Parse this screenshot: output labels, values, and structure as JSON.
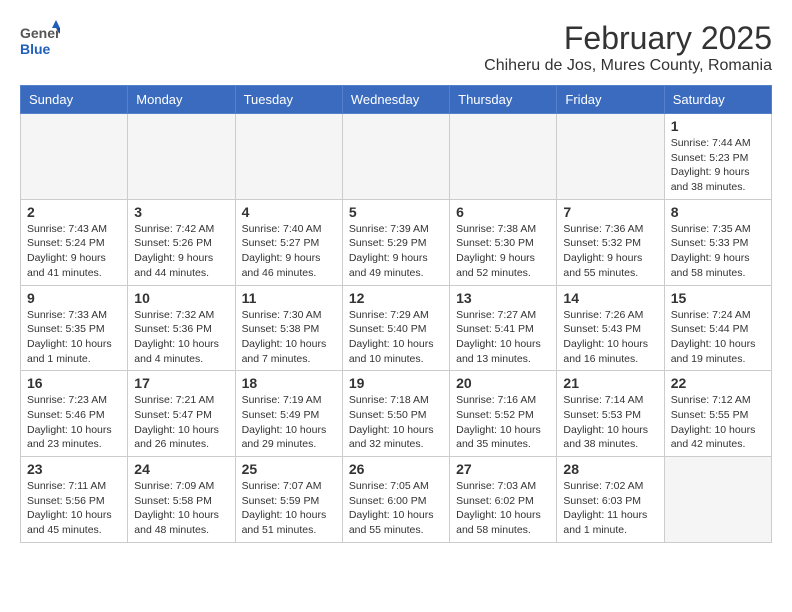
{
  "header": {
    "logo_general": "General",
    "logo_blue": "Blue",
    "month_year": "February 2025",
    "location": "Chiheru de Jos, Mures County, Romania"
  },
  "weekdays": [
    "Sunday",
    "Monday",
    "Tuesday",
    "Wednesday",
    "Thursday",
    "Friday",
    "Saturday"
  ],
  "weeks": [
    [
      {
        "day": "",
        "info": ""
      },
      {
        "day": "",
        "info": ""
      },
      {
        "day": "",
        "info": ""
      },
      {
        "day": "",
        "info": ""
      },
      {
        "day": "",
        "info": ""
      },
      {
        "day": "",
        "info": ""
      },
      {
        "day": "1",
        "info": "Sunrise: 7:44 AM\nSunset: 5:23 PM\nDaylight: 9 hours and 38 minutes."
      }
    ],
    [
      {
        "day": "2",
        "info": "Sunrise: 7:43 AM\nSunset: 5:24 PM\nDaylight: 9 hours and 41 minutes."
      },
      {
        "day": "3",
        "info": "Sunrise: 7:42 AM\nSunset: 5:26 PM\nDaylight: 9 hours and 44 minutes."
      },
      {
        "day": "4",
        "info": "Sunrise: 7:40 AM\nSunset: 5:27 PM\nDaylight: 9 hours and 46 minutes."
      },
      {
        "day": "5",
        "info": "Sunrise: 7:39 AM\nSunset: 5:29 PM\nDaylight: 9 hours and 49 minutes."
      },
      {
        "day": "6",
        "info": "Sunrise: 7:38 AM\nSunset: 5:30 PM\nDaylight: 9 hours and 52 minutes."
      },
      {
        "day": "7",
        "info": "Sunrise: 7:36 AM\nSunset: 5:32 PM\nDaylight: 9 hours and 55 minutes."
      },
      {
        "day": "8",
        "info": "Sunrise: 7:35 AM\nSunset: 5:33 PM\nDaylight: 9 hours and 58 minutes."
      }
    ],
    [
      {
        "day": "9",
        "info": "Sunrise: 7:33 AM\nSunset: 5:35 PM\nDaylight: 10 hours and 1 minute."
      },
      {
        "day": "10",
        "info": "Sunrise: 7:32 AM\nSunset: 5:36 PM\nDaylight: 10 hours and 4 minutes."
      },
      {
        "day": "11",
        "info": "Sunrise: 7:30 AM\nSunset: 5:38 PM\nDaylight: 10 hours and 7 minutes."
      },
      {
        "day": "12",
        "info": "Sunrise: 7:29 AM\nSunset: 5:40 PM\nDaylight: 10 hours and 10 minutes."
      },
      {
        "day": "13",
        "info": "Sunrise: 7:27 AM\nSunset: 5:41 PM\nDaylight: 10 hours and 13 minutes."
      },
      {
        "day": "14",
        "info": "Sunrise: 7:26 AM\nSunset: 5:43 PM\nDaylight: 10 hours and 16 minutes."
      },
      {
        "day": "15",
        "info": "Sunrise: 7:24 AM\nSunset: 5:44 PM\nDaylight: 10 hours and 19 minutes."
      }
    ],
    [
      {
        "day": "16",
        "info": "Sunrise: 7:23 AM\nSunset: 5:46 PM\nDaylight: 10 hours and 23 minutes."
      },
      {
        "day": "17",
        "info": "Sunrise: 7:21 AM\nSunset: 5:47 PM\nDaylight: 10 hours and 26 minutes."
      },
      {
        "day": "18",
        "info": "Sunrise: 7:19 AM\nSunset: 5:49 PM\nDaylight: 10 hours and 29 minutes."
      },
      {
        "day": "19",
        "info": "Sunrise: 7:18 AM\nSunset: 5:50 PM\nDaylight: 10 hours and 32 minutes."
      },
      {
        "day": "20",
        "info": "Sunrise: 7:16 AM\nSunset: 5:52 PM\nDaylight: 10 hours and 35 minutes."
      },
      {
        "day": "21",
        "info": "Sunrise: 7:14 AM\nSunset: 5:53 PM\nDaylight: 10 hours and 38 minutes."
      },
      {
        "day": "22",
        "info": "Sunrise: 7:12 AM\nSunset: 5:55 PM\nDaylight: 10 hours and 42 minutes."
      }
    ],
    [
      {
        "day": "23",
        "info": "Sunrise: 7:11 AM\nSunset: 5:56 PM\nDaylight: 10 hours and 45 minutes."
      },
      {
        "day": "24",
        "info": "Sunrise: 7:09 AM\nSunset: 5:58 PM\nDaylight: 10 hours and 48 minutes."
      },
      {
        "day": "25",
        "info": "Sunrise: 7:07 AM\nSunset: 5:59 PM\nDaylight: 10 hours and 51 minutes."
      },
      {
        "day": "26",
        "info": "Sunrise: 7:05 AM\nSunset: 6:00 PM\nDaylight: 10 hours and 55 minutes."
      },
      {
        "day": "27",
        "info": "Sunrise: 7:03 AM\nSunset: 6:02 PM\nDaylight: 10 hours and 58 minutes."
      },
      {
        "day": "28",
        "info": "Sunrise: 7:02 AM\nSunset: 6:03 PM\nDaylight: 11 hours and 1 minute."
      },
      {
        "day": "",
        "info": ""
      }
    ]
  ]
}
